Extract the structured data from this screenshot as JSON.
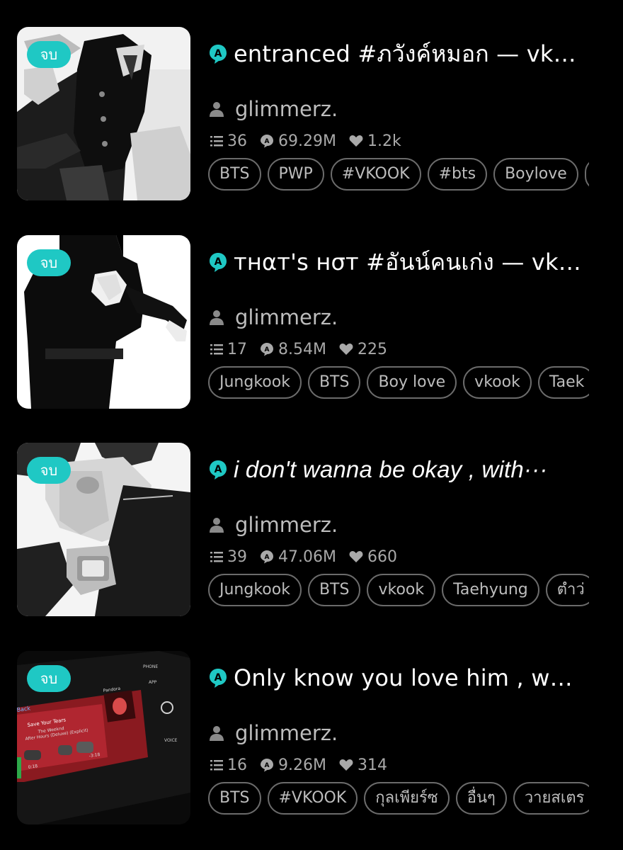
{
  "colors": {
    "background": "#000000",
    "accent": "#1fc8c4",
    "tag_border": "#6b6b6b",
    "muted_text": "#bdbdbd"
  },
  "stories": [
    {
      "status_badge": "จบ",
      "title": "entranced #ภวังค์หมอก — vk…",
      "author": "glimmerz.",
      "chapters": "36",
      "views": "69.29M",
      "likes": "1.2k",
      "tags": [
        "BTS",
        "PWP",
        "#VKOOK",
        "#bts",
        "Boylove",
        ""
      ]
    },
    {
      "status_badge": "จบ",
      "title": "тнαт'ѕ нσт #อันน์คนเก่ง — vk…",
      "author": "glimmerz.",
      "chapters": "17",
      "views": "8.54M",
      "likes": "225",
      "tags": [
        "Jungkook",
        "BTS",
        "Boy love",
        "vkook",
        "Taek"
      ]
    },
    {
      "status_badge": "จบ",
      "title": "i don't wanna be okay , with···",
      "author": "glimmerz.",
      "chapters": "39",
      "views": "47.06M",
      "likes": "660",
      "tags": [
        "Jungkook",
        "BTS",
        "vkook",
        "Taehyung",
        "ตำว่"
      ]
    },
    {
      "status_badge": "จบ",
      "title": "Only know you love him , w…",
      "author": "glimmerz.",
      "chapters": "16",
      "views": "9.26M",
      "likes": "314",
      "tags": [
        "BTS",
        "#VKOOK",
        "กุลเพียร์ซ",
        "อื่นๆ",
        "วายสเตร"
      ]
    }
  ],
  "cover_art_text": {
    "song": "Save Your Tears",
    "artist": "The Weeknd",
    "album": "After Hours (Deluxe) (Explicit)",
    "back": "Back",
    "phone": "PHONE",
    "app": "APP",
    "voice": "VOICE",
    "pandora": "Pandora",
    "time_left": "0:18",
    "time_right": "-3:18"
  }
}
